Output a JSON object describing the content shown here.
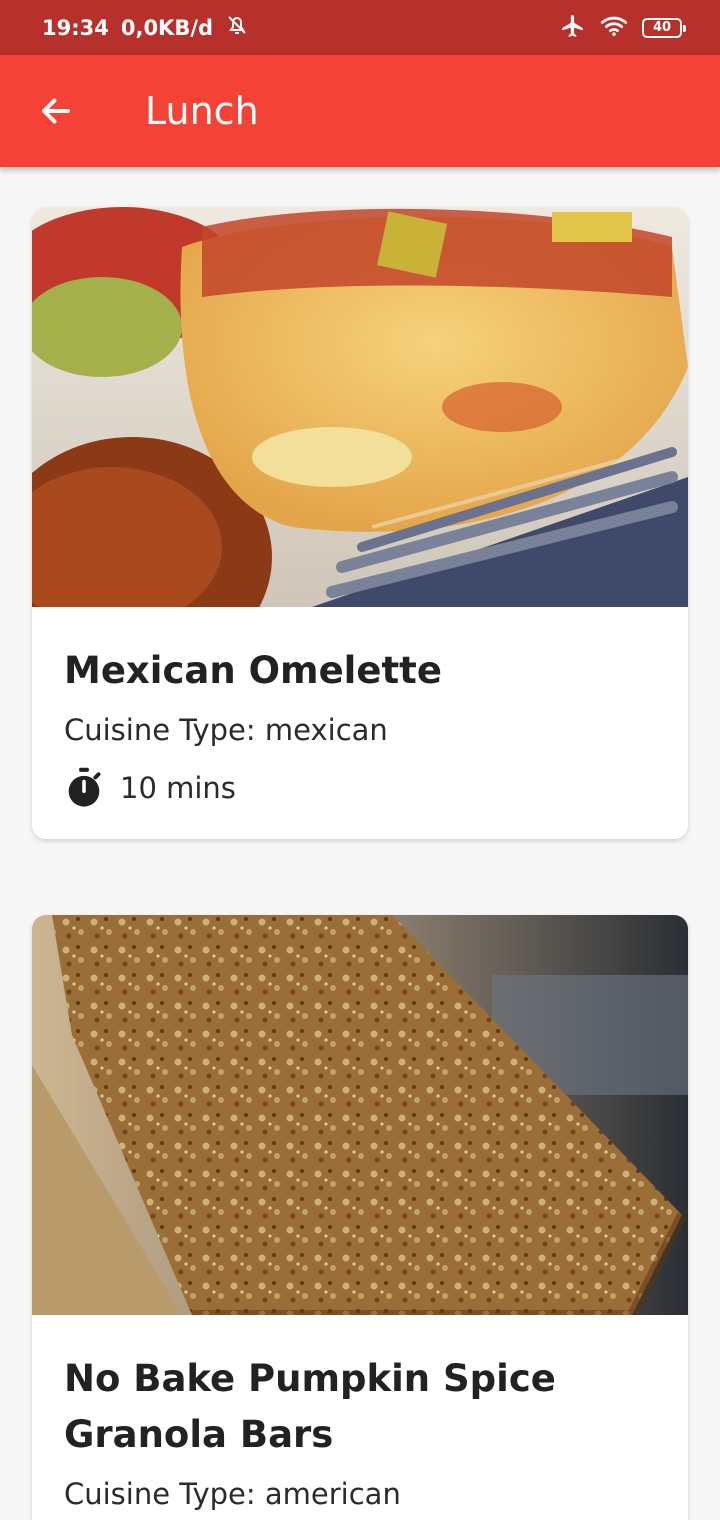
{
  "status_bar": {
    "time": "19:34",
    "network_speed": "0,0KB/d",
    "battery": "40",
    "icons": [
      "alarm-off-icon",
      "airplane-icon",
      "wifi-icon",
      "battery-icon"
    ]
  },
  "app_bar": {
    "title": "Lunch",
    "back_icon": "arrow-left-icon"
  },
  "recipes": [
    {
      "title": "Mexican Omelette",
      "cuisine": "Cuisine Type: mexican",
      "time": "10 mins",
      "image": "omelette-photo"
    },
    {
      "title": "No Bake Pumpkin Spice Granola Bars",
      "cuisine": "Cuisine Type: american",
      "image": "granola-bar-photo"
    }
  ],
  "colors": {
    "status_bar": "#b8302c",
    "app_bar": "#f44236",
    "background": "#f6f6f6",
    "card": "#ffffff"
  }
}
